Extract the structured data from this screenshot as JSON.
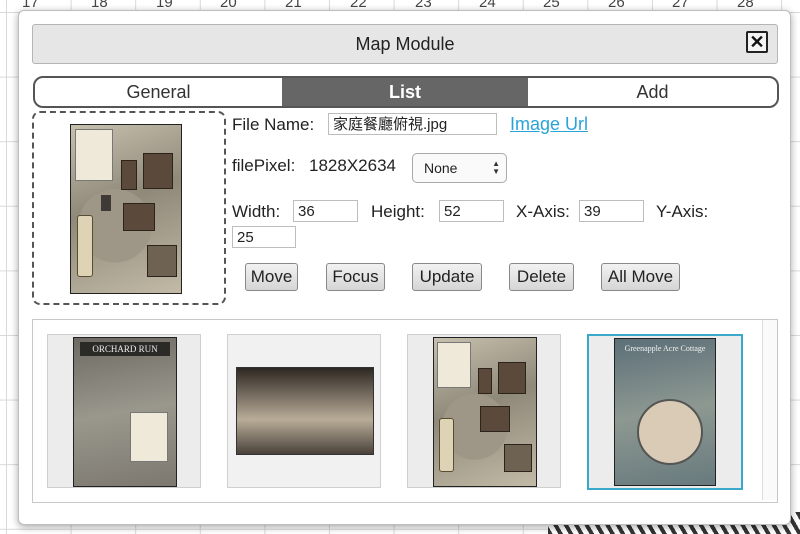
{
  "ruler": [
    "17",
    "18",
    "19",
    "20",
    "21",
    "22",
    "23",
    "24",
    "25",
    "26",
    "27",
    "28"
  ],
  "modal": {
    "title": "Map Module",
    "close_label": "✕"
  },
  "tabs": [
    {
      "label": "General",
      "active": false
    },
    {
      "label": "List",
      "active": true
    },
    {
      "label": "Add",
      "active": false
    }
  ],
  "details": {
    "file_name_label": "File Name:",
    "file_name_value": "家庭餐廳俯視.jpg",
    "image_url_link": "Image Url",
    "file_pixel_label": "filePixel:",
    "file_pixel_value": "1828X2634",
    "select_value": "None",
    "width_label": "Width:",
    "width_value": "36",
    "height_label": "Height:",
    "height_value": "52",
    "xaxis_label": "X-Axis:",
    "xaxis_value": "39",
    "yaxis_label": "Y-Axis:",
    "yaxis_value": "25"
  },
  "buttons": {
    "move": "Move",
    "focus": "Focus",
    "update": "Update",
    "delete": "Delete",
    "all_move": "All Move"
  },
  "gallery": {
    "items": [
      {
        "name": "orchard-run-map",
        "title": "ORCHARD RUN"
      },
      {
        "name": "sepia-ruins-image",
        "title": ""
      },
      {
        "name": "family-restaurant-map",
        "title": ""
      },
      {
        "name": "greenapple-cottage-map",
        "title": "Greenapple Acre Cottage"
      }
    ]
  },
  "colors": {
    "accent_tab": "#666666",
    "link": "#2aa3d8",
    "selected_border": "#3aa8c9"
  }
}
